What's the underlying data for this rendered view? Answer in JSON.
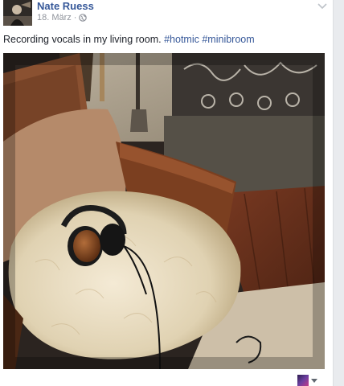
{
  "post": {
    "author": "Nate Ruess",
    "date": "18. März",
    "separator": "·",
    "text": "Recording vocals in my living room.",
    "hashtags": [
      "#hotmic",
      "#minibroom"
    ],
    "audience_icon": "globe-icon",
    "photo_subject": "headphones-on-sheepskin-chair",
    "colors": {
      "link": "#365899",
      "meta": "#90949c",
      "text": "#1d2129"
    }
  },
  "footer": {
    "actor_icon": "avatar-thumbnail",
    "caret_icon": "caret-down-icon"
  }
}
